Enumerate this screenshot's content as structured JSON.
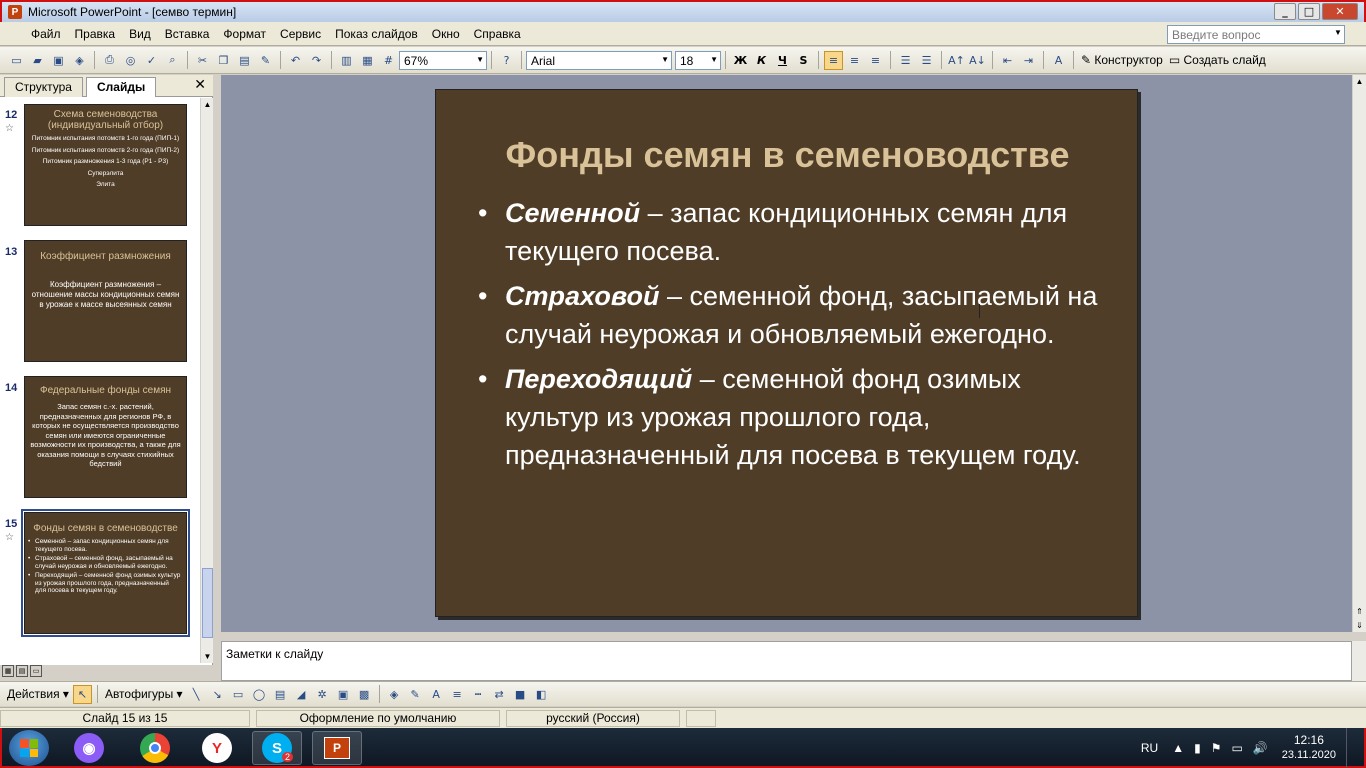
{
  "window": {
    "title": "Microsoft PowerPoint - [семво термин]",
    "minimize": "_",
    "maximize": "□",
    "close": "✕"
  },
  "menu": [
    "Файл",
    "Правка",
    "Вид",
    "Вставка",
    "Формат",
    "Сервис",
    "Показ слайдов",
    "Окно",
    "Справка"
  ],
  "ask_placeholder": "Введите вопрос",
  "toolbar": {
    "zoom": "67%",
    "font": "Arial",
    "size": "18",
    "bold": "Ж",
    "italic": "К",
    "underline": "Ч",
    "shadow": "S",
    "designer": "Конструктор",
    "new_slide": "Создать слайд"
  },
  "panel": {
    "tab_outline": "Структура",
    "tab_slides": "Слайды",
    "close": "✕"
  },
  "thumbs": [
    {
      "num": "12",
      "title": "Схема семеноводства (индивидуальный отбор)",
      "lines": [
        "Питомник испытания потомств 1-го года (ПИП-1)",
        "Питомник испытания потомств 2-го года (ПИП-2)",
        "Питомник размножения 1-3 года (Р1 - Р3)",
        "Суперэлита",
        "Элита"
      ]
    },
    {
      "num": "13",
      "title": "Коэффициент размножения",
      "body": "Коэффициент размножения – отношение массы кондиционных семян в урожае к массе высеянных семян"
    },
    {
      "num": "14",
      "title": "Федеральные фонды семян",
      "body": "Запас семян с.-х. растений, предназначенных для регионов РФ, в которых не осуществляется производство семян или имеются ограниченные возможности их производства, а также для оказания помощи в случаях стихийных бедствий"
    },
    {
      "num": "15",
      "title": "Фонды семян в семеноводстве",
      "bullets": [
        "Семенной – запас кондиционных семян для текущего посева.",
        "Страховой – семенной фонд, засыпаемый на случай неурожая и обновляемый ежегодно.",
        "Переходящий – семенной фонд озимых культур из урожая прошлого года, предназначенный для посева в текущем году."
      ]
    }
  ],
  "slide": {
    "title": "Фонды семян в семеноводстве",
    "bullets": [
      {
        "term": "Семенной",
        "rest": " – запас кондиционных семян для текущего посева."
      },
      {
        "term": "Страховой",
        "rest": " – семенной фонд, засыпаемый на случай неурожая и обновляемый ежегодно."
      },
      {
        "term": "Переходящий",
        "rest": " – семенной фонд озимых культур из урожая прошлого года, предназначенный для посева в текущем году."
      }
    ]
  },
  "notes_placeholder": "Заметки к слайду",
  "drawbar": {
    "actions": "Действия",
    "autoshapes": "Автофигуры"
  },
  "status": {
    "slide": "Слайд 15 из 15",
    "design": "Оформление по умолчанию",
    "lang": "русский (Россия)"
  },
  "taskbar": {
    "lang": "RU",
    "time": "12:16",
    "date": "23.11.2020",
    "skype_badge": "2"
  },
  "colors": {
    "slide_bg": "#4f3d27",
    "slide_title": "#d9c198",
    "edit_bg": "#8d93a6"
  }
}
